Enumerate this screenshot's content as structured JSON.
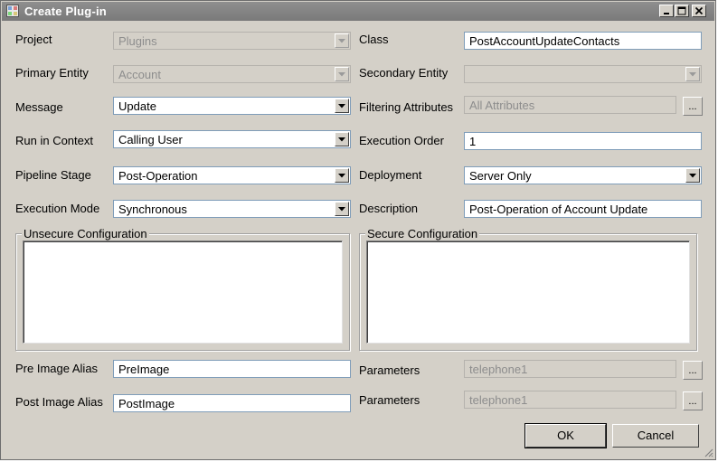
{
  "window": {
    "title": "Create Plug-in"
  },
  "form": {
    "project": {
      "label": "Project",
      "value": "Plugins"
    },
    "primary_entity": {
      "label": "Primary Entity",
      "value": "Account"
    },
    "message": {
      "label": "Message",
      "value": "Update"
    },
    "run_in_context": {
      "label": "Run in Context",
      "value": "Calling User"
    },
    "pipeline_stage": {
      "label": "Pipeline Stage",
      "value": "Post-Operation"
    },
    "execution_mode": {
      "label": "Execution Mode",
      "value": "Synchronous"
    },
    "class": {
      "label": "Class",
      "value": "PostAccountUpdateContacts"
    },
    "secondary_entity": {
      "label": "Secondary Entity",
      "value": ""
    },
    "filtering_attributes": {
      "label": "Filtering Attributes",
      "value": "All Attributes"
    },
    "execution_order": {
      "label": "Execution Order",
      "value": "1"
    },
    "deployment": {
      "label": "Deployment",
      "value": "Server Only"
    },
    "description": {
      "label": "Description",
      "value": "Post-Operation of Account Update"
    },
    "unsecure_configuration": {
      "label": "Unsecure Configuration",
      "value": ""
    },
    "secure_configuration": {
      "label": "Secure Configuration",
      "value": ""
    },
    "pre_image_alias": {
      "label": "Pre Image Alias",
      "value": "PreImage"
    },
    "post_image_alias": {
      "label": "Post Image Alias",
      "value": "PostImage"
    },
    "pre_parameters": {
      "label": "Parameters",
      "value": "telephone1"
    },
    "post_parameters": {
      "label": "Parameters",
      "value": "telephone1"
    },
    "ellipsis": "..."
  },
  "buttons": {
    "ok": "OK",
    "cancel": "Cancel"
  }
}
